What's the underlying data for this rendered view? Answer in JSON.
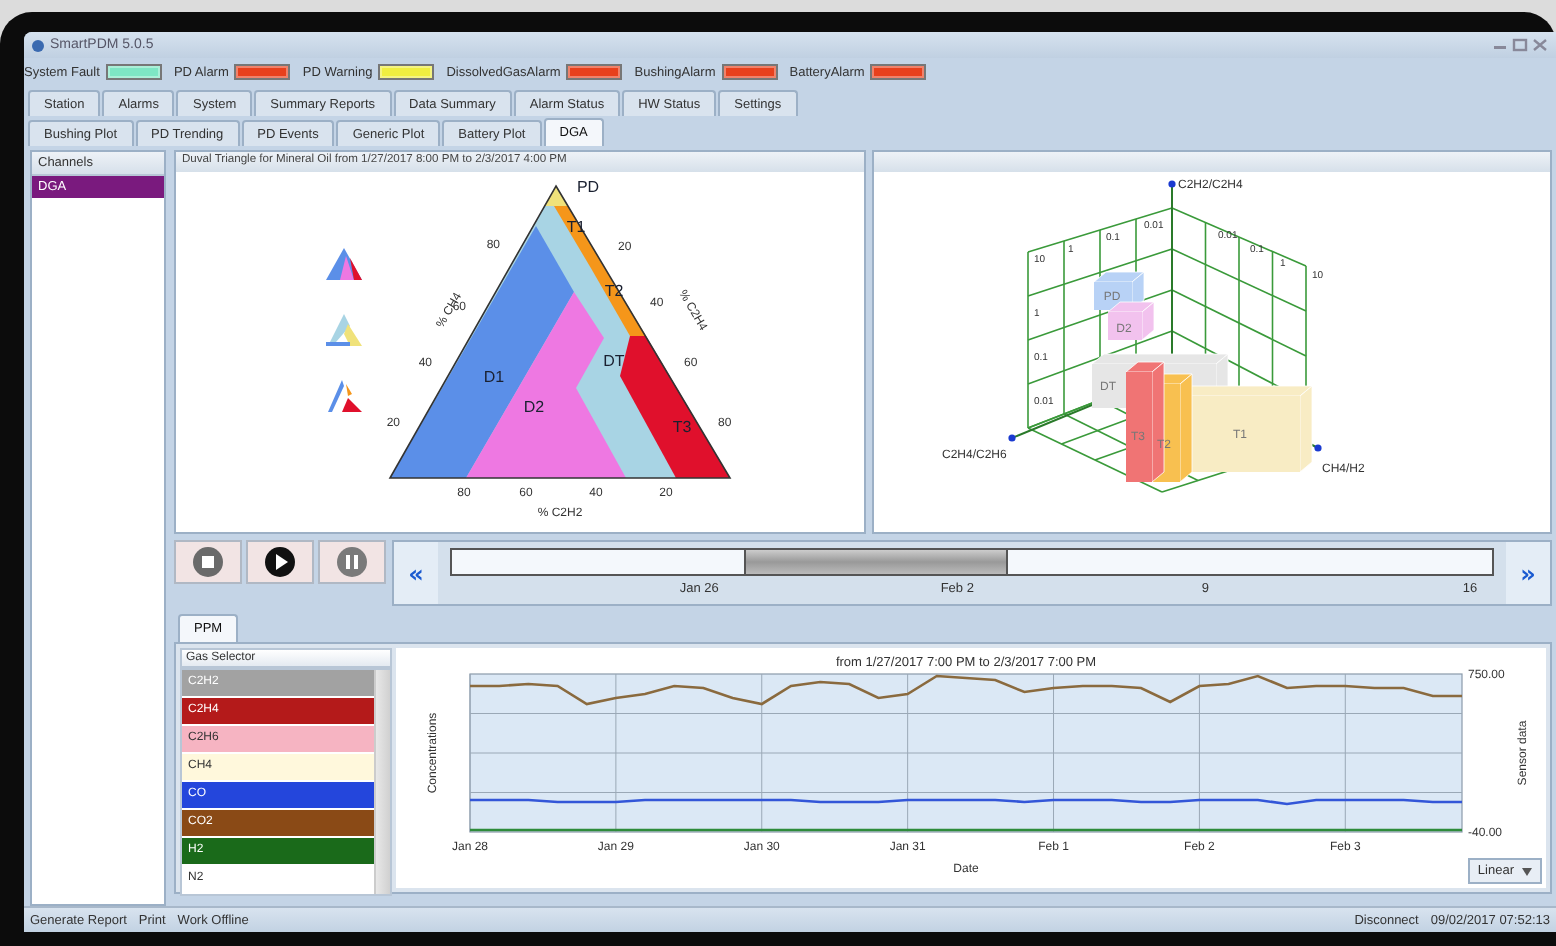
{
  "window": {
    "title": "SmartPDM 5.0.5"
  },
  "alarms": [
    {
      "label": "System Fault",
      "color": "#7ee6c4"
    },
    {
      "label": "PD Alarm",
      "color": "#e8401c"
    },
    {
      "label": "PD Warning",
      "color": "#f0ee40"
    },
    {
      "label": "DissolvedGasAlarm",
      "color": "#e8401c"
    },
    {
      "label": "BushingAlarm",
      "color": "#e8401c"
    },
    {
      "label": "BatteryAlarm",
      "color": "#e8401c"
    }
  ],
  "main_tabs": [
    {
      "label": "Station",
      "selected": false
    },
    {
      "label": "Alarms",
      "selected": false
    },
    {
      "label": "System",
      "selected": false
    },
    {
      "label": "Summary Reports",
      "selected": false
    },
    {
      "label": "Data Summary",
      "selected": false
    },
    {
      "label": "Alarm Status",
      "selected": false
    },
    {
      "label": "HW Status",
      "selected": false
    },
    {
      "label": "Settings",
      "selected": false
    }
  ],
  "sub_tabs": [
    {
      "label": "Bushing Plot",
      "selected": false
    },
    {
      "label": "PD Trending",
      "selected": false
    },
    {
      "label": "PD Events",
      "selected": false
    },
    {
      "label": "Generic Plot",
      "selected": false
    },
    {
      "label": "Battery Plot",
      "selected": false
    },
    {
      "label": "DGA",
      "selected": true
    }
  ],
  "sidebar": {
    "header": "Channels",
    "items": [
      {
        "label": "DGA",
        "selected": true
      }
    ]
  },
  "duval": {
    "title": "Duval Triangle for Mineral Oil from 1/27/2017 8:00 PM to 2/3/2017 4:00 PM",
    "zones": [
      {
        "label": "DT",
        "color": "#a8d4e4"
      },
      {
        "label": "D1",
        "color": "#5b8fe8"
      },
      {
        "label": "D2",
        "color": "#ee78e2"
      },
      {
        "label": "T1",
        "color": "#f5961a"
      },
      {
        "label": "T2",
        "color": "#f5961a"
      },
      {
        "label": "T3",
        "color": "#e0102c"
      },
      {
        "label": "PD",
        "color": "#f0e27a"
      }
    ],
    "left_ticks": [
      "80",
      "60",
      "40",
      "20"
    ],
    "right_ticks": [
      "20",
      "40",
      "60",
      "80"
    ],
    "bottom_ticks": [
      "80",
      "60",
      "40",
      "20"
    ],
    "left_axis": "% CH4",
    "right_axis": "% C2H4",
    "bottom_axis": "% C2H2"
  },
  "rogers": {
    "vertical_axis": "C2H2/C2H4",
    "left_axis": "C2H4/C2H6",
    "right_axis": "CH4/H2",
    "left_wall_ticks": [
      "10",
      "1",
      "0.1",
      "0.01"
    ],
    "right_wall_ticks": [
      "0.01",
      "0.1",
      "1",
      "10"
    ],
    "vertical_ticks": [
      "1",
      "0.1",
      "0.01"
    ],
    "boxes": [
      {
        "label": "DT",
        "color": "#e6e6e6"
      },
      {
        "label": "PD",
        "color": "#b8d2f6"
      },
      {
        "label": "D2",
        "color": "#f2c2ee"
      },
      {
        "label": "T3",
        "color": "#f07474"
      },
      {
        "label": "T2",
        "color": "#f8c050"
      },
      {
        "label": "T1",
        "color": "#f8ecc4"
      }
    ]
  },
  "player": {
    "buttons": [
      {
        "kind": "stop"
      },
      {
        "kind": "play"
      },
      {
        "kind": "pause"
      }
    ]
  },
  "timeline": {
    "prev": "«",
    "next": "»",
    "ticks": [
      "Jan 26",
      "Feb 2",
      "9",
      "16"
    ]
  },
  "ppm_tab": {
    "label": "PPM",
    "selected": true
  },
  "gas_selector": {
    "header": "Gas Selector",
    "items": [
      {
        "label": "C2H2",
        "color": "#a2a2a2"
      },
      {
        "label": "C2H4",
        "color": "#b41a1a"
      },
      {
        "label": "C2H6",
        "color": "#f6b4c2"
      },
      {
        "label": "CH4",
        "color": "#fff8dc"
      },
      {
        "label": "CO",
        "color": "#2446dc"
      },
      {
        "label": "CO2",
        "color": "#8a4a16"
      },
      {
        "label": "H2",
        "color": "#1a6a1a"
      },
      {
        "label": "N2",
        "color": "#ffffff"
      }
    ]
  },
  "trend": {
    "right_label": "Sensor data",
    "scale_button": "Linear",
    "chart_data": {
      "type": "line",
      "title": "from 1/27/2017 7:00 PM to 2/3/2017 7:00 PM",
      "xlabel": "Date",
      "ylabel": "Concentrations",
      "categories": [
        "Jan 28",
        null,
        null,
        null,
        null,
        "Jan 29",
        null,
        null,
        null,
        null,
        "Jan 30",
        null,
        null,
        null,
        null,
        "Jan 31",
        null,
        null,
        null,
        null,
        "Feb 1",
        null,
        null,
        null,
        null,
        "Feb 2",
        null,
        null,
        null,
        null,
        "Feb 3",
        null,
        null,
        null,
        null
      ],
      "ylim": [
        -40,
        750
      ],
      "grid": true,
      "yticks": [
        {
          "value": 750,
          "label": "750.00"
        },
        {
          "value": -40,
          "label": "-40.00"
        }
      ],
      "series": [
        {
          "color": "#8a6a3e",
          "values": [
            690,
            690,
            700,
            690,
            600,
            630,
            650,
            690,
            680,
            630,
            600,
            690,
            710,
            700,
            630,
            650,
            740,
            730,
            720,
            660,
            680,
            690,
            690,
            680,
            610,
            690,
            700,
            740,
            680,
            690,
            690,
            680,
            680,
            640,
            640
          ]
        },
        {
          "color": "#3356d8",
          "values": [
            120,
            120,
            120,
            110,
            110,
            110,
            120,
            120,
            120,
            120,
            120,
            120,
            110,
            110,
            110,
            120,
            120,
            120,
            120,
            110,
            120,
            120,
            120,
            110,
            110,
            120,
            120,
            120,
            100,
            120,
            120,
            120,
            120,
            110,
            110
          ]
        },
        {
          "color": "#2e8b3a",
          "values": [
            -30,
            -30,
            -30,
            -30,
            -30,
            -30,
            -30,
            -30,
            -30,
            -30,
            -30,
            -30,
            -30,
            -30,
            -30,
            -30,
            -30,
            -30,
            -30,
            -30,
            -30,
            -30,
            -30,
            -30,
            -30,
            -30,
            -30,
            -30,
            -30,
            -30,
            -30,
            -30,
            -30,
            -30,
            -30
          ]
        }
      ]
    }
  },
  "status_bar": {
    "left": [
      "Generate Report",
      "Print",
      "Work Offline"
    ],
    "right": [
      "Disconnect",
      "09/02/2017 07:52:13"
    ]
  }
}
